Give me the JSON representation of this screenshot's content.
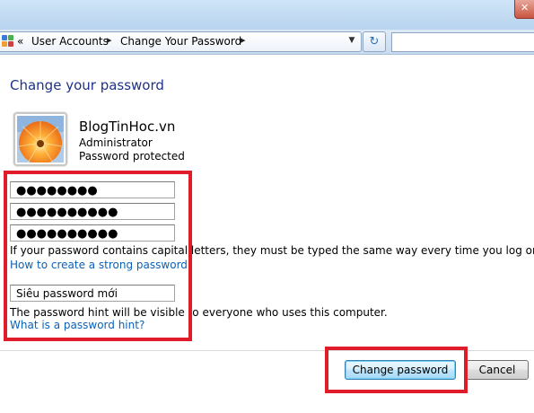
{
  "window": {
    "close_glyph": "✕"
  },
  "address_bar": {
    "back_glyph": "«",
    "crumbs": [
      "User Accounts",
      "Change Your Password"
    ],
    "separator_glyph": "▸",
    "dropdown_glyph": "▼",
    "refresh_glyph": "↻",
    "search_value": ""
  },
  "page": {
    "title": "Change your password"
  },
  "user": {
    "name": "BlogTinHoc.vn",
    "role": "Administrator",
    "status": "Password protected",
    "avatar_icon": "orange-flower-icon"
  },
  "form": {
    "current_password_mask": "●●●●●●●●",
    "new_password_mask": "●●●●●●●●●●",
    "confirm_password_mask": "●●●●●●●●●●",
    "capitals_note": "If your password contains capital letters, they must be typed the same way every time you log on.",
    "strong_password_link": "How to create a strong password",
    "hint_value": "Siêu password mới",
    "hint_note": "The password hint will be visible to everyone who uses this computer.",
    "hint_link": "What is a password hint?"
  },
  "buttons": {
    "change_password": "Change password",
    "cancel": "Cancel"
  },
  "colors": {
    "title_blue": "#1e3287",
    "link_blue": "#0b61b8",
    "highlight_red": "#e01b2a"
  }
}
